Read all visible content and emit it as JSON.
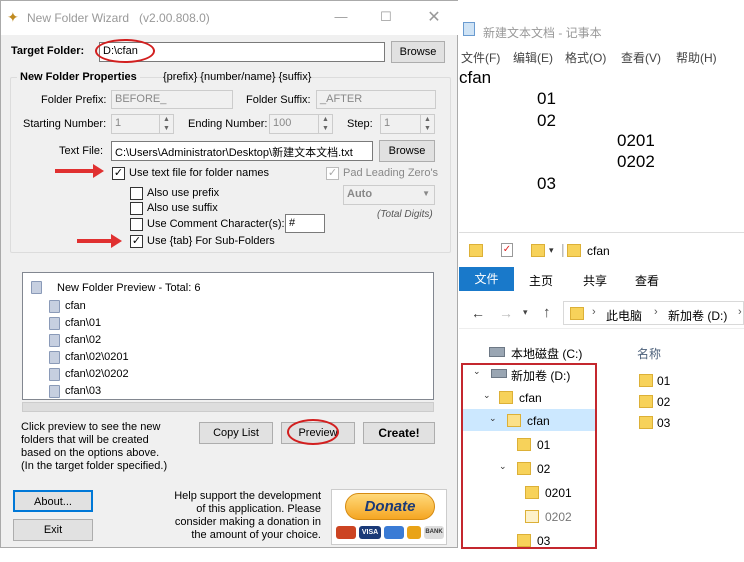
{
  "wizard": {
    "title": "New Folder Wizard",
    "version": "(v2.00.808.0)",
    "target_folder_label": "Target Folder:",
    "target_folder_value": "D:\\cfan",
    "browse_label": "Browse",
    "props_title": "New Folder Properties",
    "props_pattern": "{prefix} {number/name} {suffix}",
    "prefix_label": "Folder Prefix:",
    "prefix_value": "BEFORE_",
    "suffix_label": "Folder Suffix:",
    "suffix_value": "_AFTER",
    "start_label": "Starting Number:",
    "start_value": "1",
    "end_label": "Ending Number:",
    "end_value": "100",
    "step_label": "Step:",
    "step_value": "1",
    "textfile_label": "Text File:",
    "textfile_value": "C:\\Users\\Administrator\\Desktop\\新建文本文档.txt",
    "browse2_label": "Browse",
    "use_text_file": "Use text file for folder names",
    "pad_zeros": "Pad Leading Zero's",
    "also_prefix": "Also use prefix",
    "also_suffix": "Also use suffix",
    "comment_char": "Use Comment Character(s):",
    "comment_value": "#",
    "use_tab": "Use {tab} For Sub-Folders",
    "auto_value": "Auto",
    "total_digits": "(Total Digits)",
    "preview_header": "New Folder Preview - Total: 6",
    "preview_items": [
      "cfan",
      "cfan\\01",
      "cfan\\02",
      "cfan\\02\\0201",
      "cfan\\02\\0202",
      "cfan\\03"
    ],
    "hint": [
      "Click preview to see the new",
      "folders that will be created",
      "based on the options above.",
      "(In the target folder specified.)"
    ],
    "copy_list": "Copy List",
    "preview_btn": "Preview",
    "create_btn": "Create!",
    "about_btn": "About...",
    "exit_btn": "Exit",
    "support": [
      "Help support the development",
      "of this application. Please",
      "consider making a donation in",
      "the amount of your choice."
    ],
    "donate": "Donate",
    "cards": [
      "VISA",
      "BANK"
    ]
  },
  "notepad": {
    "title": "新建文本文档 - 记事本",
    "menu": [
      "文件(F)",
      "编辑(E)",
      "格式(O)",
      "查看(V)",
      "帮助(H)"
    ],
    "lines": [
      "cfan",
      "01",
      "02",
      "0201",
      "0202",
      "03"
    ]
  },
  "explorer": {
    "title": "cfan",
    "ribbon": [
      "文件",
      "主页",
      "共享",
      "查看"
    ],
    "breadcrumb": [
      "此电脑",
      "新加卷 (D:)"
    ],
    "tree": [
      "本地磁盘 (C:)",
      "新加卷 (D:)",
      "cfan",
      "cfan",
      "01",
      "02",
      "0201",
      "0202",
      "03"
    ],
    "col_name": "名称",
    "files": [
      "01",
      "02",
      "03"
    ]
  }
}
